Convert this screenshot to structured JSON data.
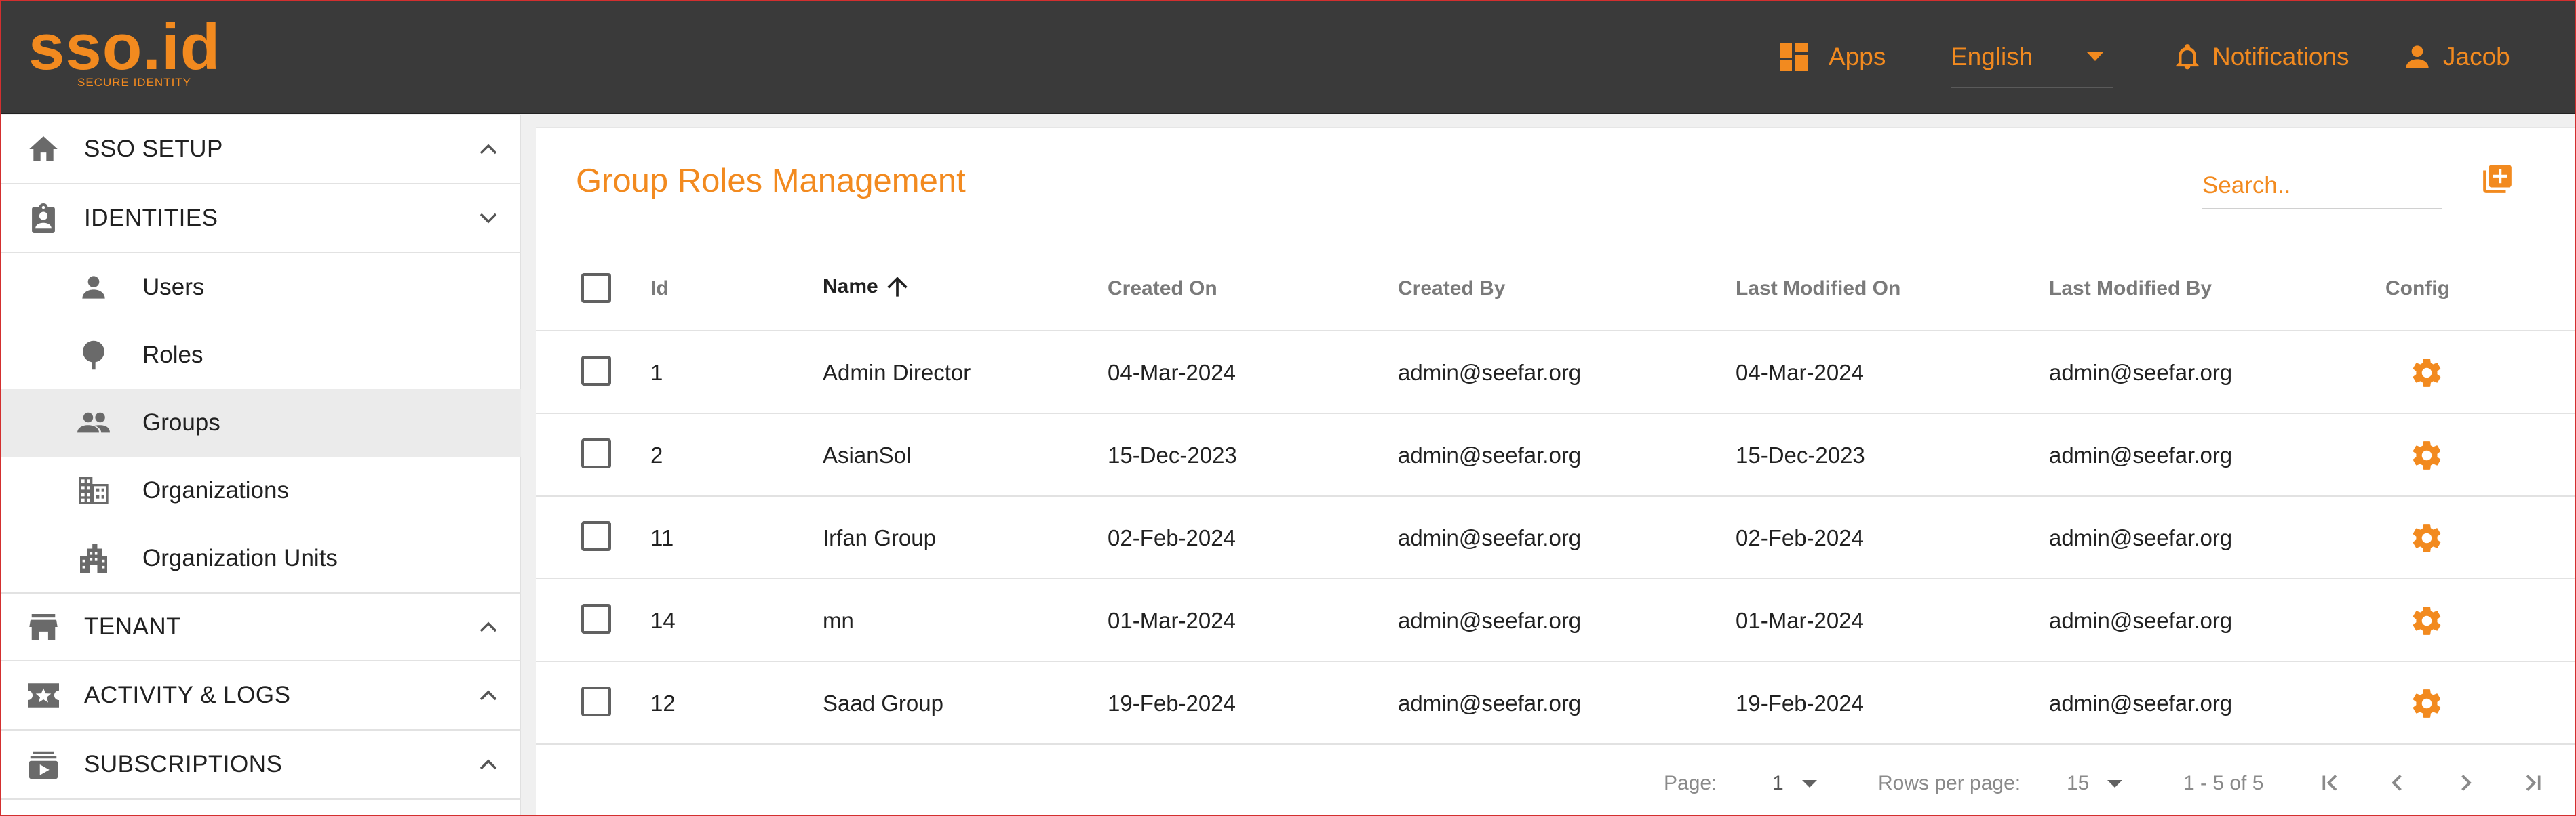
{
  "header": {
    "logo_text": "sso.id",
    "logo_tagline": "SECURE IDENTITY",
    "apps_label": "Apps",
    "language": "English",
    "notifications_label": "Notifications",
    "user_name": "Jacob",
    "accent_color": "#f28a1f",
    "background_color": "#3a3a3a"
  },
  "sidebar": {
    "sections": [
      {
        "label": "SSO SETUP",
        "icon": "home-icon",
        "expanded": false
      },
      {
        "label": "IDENTITIES",
        "icon": "badge-icon",
        "expanded": true
      },
      {
        "label": "TENANT",
        "icon": "store-icon",
        "expanded": false
      },
      {
        "label": "ACTIVITY & LOGS",
        "icon": "ticket-star-icon",
        "expanded": false
      },
      {
        "label": "SUBSCRIPTIONS",
        "icon": "subscriptions-icon",
        "expanded": false
      }
    ],
    "identity_items": [
      {
        "label": "Users",
        "icon": "person-icon"
      },
      {
        "label": "Roles",
        "icon": "pin-icon"
      },
      {
        "label": "Groups",
        "icon": "people-icon",
        "active": true
      },
      {
        "label": "Organizations",
        "icon": "building-icon"
      },
      {
        "label": "Organization Units",
        "icon": "city-icon"
      }
    ]
  },
  "main": {
    "title": "Group Roles Management",
    "search_placeholder": "Search..",
    "columns": [
      "Id",
      "Name",
      "Created On",
      "Created By",
      "Last Modified On",
      "Last Modified By",
      "Config"
    ],
    "sort_column": "Name",
    "sort_direction": "ascending",
    "rows": [
      {
        "id": "1",
        "name": "Admin Director",
        "created_on": "04-Mar-2024",
        "created_by": "admin@seefar.org",
        "modified_on": "04-Mar-2024",
        "modified_by": "admin@seefar.org"
      },
      {
        "id": "2",
        "name": "AsianSol",
        "created_on": "15-Dec-2023",
        "created_by": "admin@seefar.org",
        "modified_on": "15-Dec-2023",
        "modified_by": "admin@seefar.org"
      },
      {
        "id": "11",
        "name": "Irfan Group",
        "created_on": "02-Feb-2024",
        "created_by": "admin@seefar.org",
        "modified_on": "02-Feb-2024",
        "modified_by": "admin@seefar.org"
      },
      {
        "id": "14",
        "name": "mn",
        "created_on": "01-Mar-2024",
        "created_by": "admin@seefar.org",
        "modified_on": "01-Mar-2024",
        "modified_by": "admin@seefar.org"
      },
      {
        "id": "12",
        "name": "Saad Group",
        "created_on": "19-Feb-2024",
        "created_by": "admin@seefar.org",
        "modified_on": "19-Feb-2024",
        "modified_by": "admin@seefar.org"
      }
    ],
    "pagination": {
      "page_label": "Page:",
      "page_value": "1",
      "rows_label": "Rows per page:",
      "rows_value": "15",
      "range_text": "1 - 5 of 5"
    }
  }
}
